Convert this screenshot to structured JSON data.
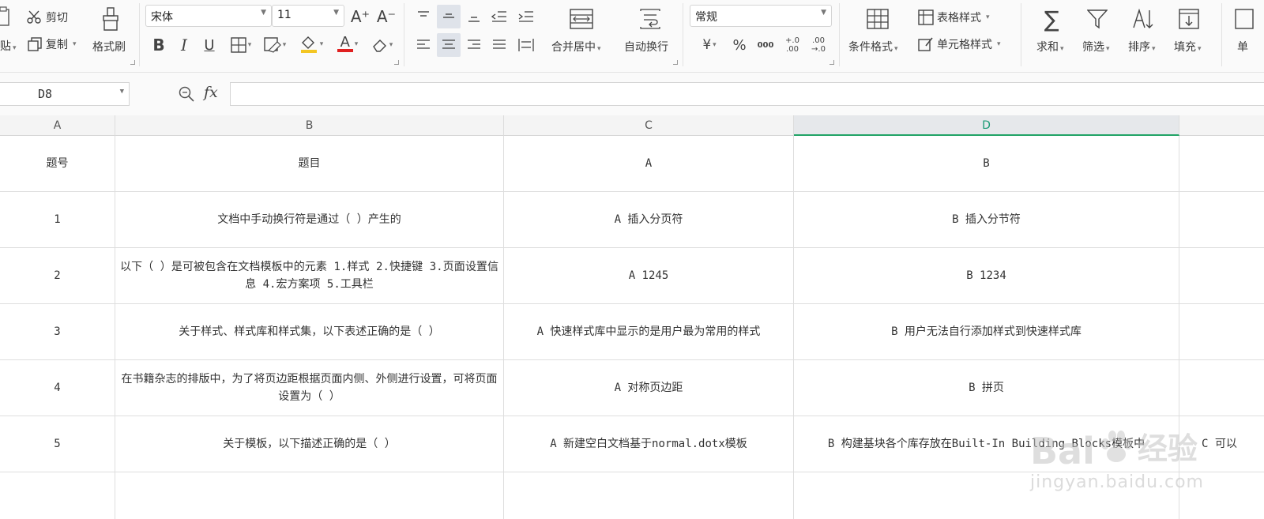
{
  "ribbon": {
    "clipboard": {
      "paste_label": "贴",
      "cut_label": "剪切",
      "copy_label": "复制",
      "format_painter_label": "格式刷"
    },
    "font": {
      "name": "宋体",
      "size": "11",
      "bold": "B",
      "italic": "I",
      "underline": "U",
      "font_color_glyph": "A",
      "grow_glyph": "A⁺",
      "shrink_glyph": "A⁻"
    },
    "alignment": {
      "merge_label": "合并居中",
      "wrap_label": "自动换行"
    },
    "number": {
      "format": "常规",
      "currency": "¥",
      "percent": "%",
      "thousands": "000",
      "inc_decimal": "+.0 .00",
      "dec_decimal": ".00 →.0"
    },
    "styles": {
      "conditional_label": "条件格式",
      "table_style_label": "表格样式",
      "cell_style_label": "单元格样式"
    },
    "editing": {
      "sum_label": "求和",
      "filter_label": "筛选",
      "sort_label": "排序",
      "fill_label": "填充",
      "last_label": "单"
    }
  },
  "formula_bar": {
    "cell_ref": "D8",
    "fx_label": "fx",
    "formula": ""
  },
  "sheet": {
    "columns": [
      "A",
      "B",
      "C",
      "D"
    ],
    "selected_column": "D",
    "header_row": {
      "a": "题号",
      "b": "题目",
      "c": "A",
      "d": "B"
    },
    "rows": [
      {
        "a": "1",
        "b": "文档中手动换行符是通过（ ）产生的",
        "c": "A 插入分页符",
        "d": "B 插入分节符",
        "e": ""
      },
      {
        "a": "2",
        "b": "以下（ ）是可被包含在文档模板中的元素 1.样式 2.快捷键 3.页面设置信息 4.宏方案项 5.工具栏",
        "c": "A 1245",
        "d": "B 1234",
        "e": ""
      },
      {
        "a": "3",
        "b": "关于样式、样式库和样式集，以下表述正确的是（ ）",
        "c": "A 快速样式库中显示的是用户最为常用的样式",
        "d": "B 用户无法自行添加样式到快速样式库",
        "e": ""
      },
      {
        "a": "4",
        "b": "在书籍杂志的排版中，为了将页边距根据页面内侧、外侧进行设置，可将页面设置为（ ）",
        "c": "A 对称页边距",
        "d": "B 拼页",
        "e": ""
      },
      {
        "a": "5",
        "b": "关于模板，以下描述正确的是（ ）",
        "c": "A 新建空白文档基于normal.dotx模板",
        "d": "B 构建基块各个库存放在Built-In Building Blocks模板中",
        "e": "C 可以"
      }
    ]
  },
  "watermark": {
    "brand": "Bai",
    "brand_cn": "经验",
    "url": "jingyan.baidu.com"
  }
}
